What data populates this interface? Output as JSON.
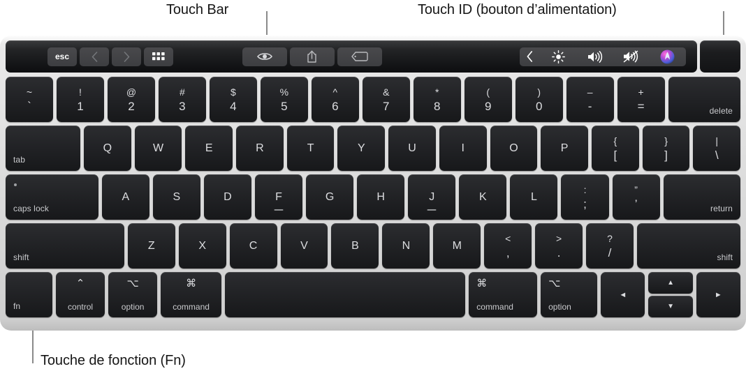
{
  "callouts": [
    {
      "id": "touch-bar",
      "label": "Touch Bar"
    },
    {
      "id": "touch-id",
      "label": "Touch ID (bouton d’alimentation)"
    },
    {
      "id": "fn-key",
      "label": "Touche de fonction (Fn)"
    }
  ],
  "touch_bar": {
    "left_buttons": [
      {
        "name": "esc-button",
        "label": "esc",
        "icon": null
      },
      {
        "name": "back-button",
        "label": "‹",
        "icon": "chevron-left-icon"
      },
      {
        "name": "forward-button",
        "label": "›",
        "icon": "chevron-right-icon"
      },
      {
        "name": "app-expose-button",
        "label": "",
        "icon": "grid-icon"
      }
    ],
    "middle_buttons": [
      {
        "name": "quick-look-button",
        "label": "",
        "icon": "eye-icon"
      },
      {
        "name": "share-button",
        "label": "",
        "icon": "share-icon"
      },
      {
        "name": "tag-button",
        "label": "",
        "icon": "tag-icon"
      }
    ],
    "control_strip": [
      {
        "name": "expand-control-strip-button",
        "label": "",
        "icon": "chevron-left-icon"
      },
      {
        "name": "brightness-button",
        "label": "",
        "icon": "brightness-icon"
      },
      {
        "name": "volume-button",
        "label": "",
        "icon": "volume-up-icon"
      },
      {
        "name": "mute-button",
        "label": "",
        "icon": "volume-mute-icon"
      },
      {
        "name": "siri-button",
        "label": "",
        "icon": "siri-icon"
      }
    ],
    "touch_id": {
      "name": "touch-id-key",
      "label": ""
    }
  },
  "rows": {
    "number": [
      {
        "name": "key-grave",
        "type": "dual",
        "top": "~",
        "bottom": "`"
      },
      {
        "name": "key-1",
        "type": "dual",
        "top": "!",
        "bottom": "1"
      },
      {
        "name": "key-2",
        "type": "dual",
        "top": "@",
        "bottom": "2"
      },
      {
        "name": "key-3",
        "type": "dual",
        "top": "#",
        "bottom": "3"
      },
      {
        "name": "key-4",
        "type": "dual",
        "top": "$",
        "bottom": "4"
      },
      {
        "name": "key-5",
        "type": "dual",
        "top": "%",
        "bottom": "5"
      },
      {
        "name": "key-6",
        "type": "dual",
        "top": "^",
        "bottom": "6"
      },
      {
        "name": "key-7",
        "type": "dual",
        "top": "&",
        "bottom": "7"
      },
      {
        "name": "key-8",
        "type": "dual",
        "top": "*",
        "bottom": "8"
      },
      {
        "name": "key-9",
        "type": "dual",
        "top": "(",
        "bottom": "9"
      },
      {
        "name": "key-0",
        "type": "dual",
        "top": ")",
        "bottom": "0"
      },
      {
        "name": "key-minus",
        "type": "dual",
        "top": "–",
        "bottom": "-"
      },
      {
        "name": "key-equal",
        "type": "dual",
        "top": "+",
        "bottom": "="
      },
      {
        "name": "key-delete",
        "type": "corner-br",
        "label": "delete",
        "width": "w-delete"
      }
    ],
    "top": [
      {
        "name": "key-tab",
        "type": "corner-bl",
        "label": "tab",
        "width": "w-tab"
      },
      {
        "name": "key-q",
        "type": "center",
        "label": "Q"
      },
      {
        "name": "key-w",
        "type": "center",
        "label": "W"
      },
      {
        "name": "key-e",
        "type": "center",
        "label": "E"
      },
      {
        "name": "key-r",
        "type": "center",
        "label": "R"
      },
      {
        "name": "key-t",
        "type": "center",
        "label": "T"
      },
      {
        "name": "key-y",
        "type": "center",
        "label": "Y"
      },
      {
        "name": "key-u",
        "type": "center",
        "label": "U"
      },
      {
        "name": "key-i",
        "type": "center",
        "label": "I"
      },
      {
        "name": "key-o",
        "type": "center",
        "label": "O"
      },
      {
        "name": "key-p",
        "type": "center",
        "label": "P"
      },
      {
        "name": "key-bracket-left",
        "type": "dual",
        "top": "{",
        "bottom": "["
      },
      {
        "name": "key-bracket-right",
        "type": "dual",
        "top": "}",
        "bottom": "]"
      },
      {
        "name": "key-backslash",
        "type": "dual",
        "top": "|",
        "bottom": "\\"
      }
    ],
    "home": [
      {
        "name": "key-caps-lock",
        "type": "caps",
        "label": "caps lock",
        "width": "w-caps"
      },
      {
        "name": "key-a",
        "type": "center",
        "label": "A"
      },
      {
        "name": "key-s",
        "type": "center",
        "label": "S"
      },
      {
        "name": "key-d",
        "type": "center",
        "label": "D"
      },
      {
        "name": "key-f",
        "type": "center",
        "label": "F",
        "homing": true
      },
      {
        "name": "key-g",
        "type": "center",
        "label": "G"
      },
      {
        "name": "key-h",
        "type": "center",
        "label": "H"
      },
      {
        "name": "key-j",
        "type": "center",
        "label": "J",
        "homing": true
      },
      {
        "name": "key-k",
        "type": "center",
        "label": "K"
      },
      {
        "name": "key-l",
        "type": "center",
        "label": "L"
      },
      {
        "name": "key-semicolon",
        "type": "dual",
        "top": ":",
        "bottom": ";"
      },
      {
        "name": "key-quote",
        "type": "dual",
        "top": "”",
        "bottom": "’"
      },
      {
        "name": "key-return",
        "type": "corner-br",
        "label": "return",
        "width": "w-return"
      }
    ],
    "shift": [
      {
        "name": "key-shift-left",
        "type": "corner-bl",
        "label": "shift",
        "width": "w-shiftl"
      },
      {
        "name": "key-z",
        "type": "center",
        "label": "Z"
      },
      {
        "name": "key-x",
        "type": "center",
        "label": "X"
      },
      {
        "name": "key-c",
        "type": "center",
        "label": "C"
      },
      {
        "name": "key-v",
        "type": "center",
        "label": "V"
      },
      {
        "name": "key-b",
        "type": "center",
        "label": "B"
      },
      {
        "name": "key-n",
        "type": "center",
        "label": "N"
      },
      {
        "name": "key-m",
        "type": "center",
        "label": "M"
      },
      {
        "name": "key-comma",
        "type": "dual",
        "top": "<",
        "bottom": ","
      },
      {
        "name": "key-period",
        "type": "dual",
        "top": ">",
        "bottom": "."
      },
      {
        "name": "key-slash",
        "type": "dual",
        "top": "?",
        "bottom": "/"
      },
      {
        "name": "key-shift-right",
        "type": "corner-br",
        "label": "shift",
        "width": "w-shiftr"
      }
    ],
    "bottom": [
      {
        "name": "key-fn",
        "type": "corner-bl",
        "label": "fn",
        "width": "w-fn"
      },
      {
        "name": "key-control",
        "type": "mod",
        "symbol": "⌃",
        "label": "control",
        "width": "w-ctrl"
      },
      {
        "name": "key-option-left",
        "type": "mod",
        "symbol": "⌥",
        "label": "option",
        "width": "w-ctrl"
      },
      {
        "name": "key-command-left",
        "type": "mod",
        "symbol": "⌘",
        "label": "command",
        "width": ""
      },
      {
        "name": "key-space",
        "type": "blank",
        "label": "",
        "width": "w-space"
      },
      {
        "name": "key-command-right",
        "type": "mod-left",
        "symbol": "⌘",
        "label": "command",
        "width": ""
      },
      {
        "name": "key-option-right",
        "type": "mod-left",
        "symbol": "⌥",
        "label": "option",
        "width": "w-ctrl"
      },
      {
        "name": "key-arrow-left",
        "type": "arrow",
        "label": "◄",
        "width": "w-arrow"
      },
      {
        "name": "key-arrow-updown",
        "type": "arrow-stack",
        "up": "▲",
        "down": "▼",
        "width": "w-arrowstack"
      },
      {
        "name": "key-arrow-right",
        "type": "arrow",
        "label": "►",
        "width": "w-arrow"
      }
    ]
  },
  "colors": {
    "key_face": "#232427",
    "chassis": "#dcdcdc",
    "legend": "#dcdde0",
    "callout_text": "#161616",
    "leader_line": "#8a8a8a",
    "touch_bar_bg": "#1a1b1d"
  }
}
